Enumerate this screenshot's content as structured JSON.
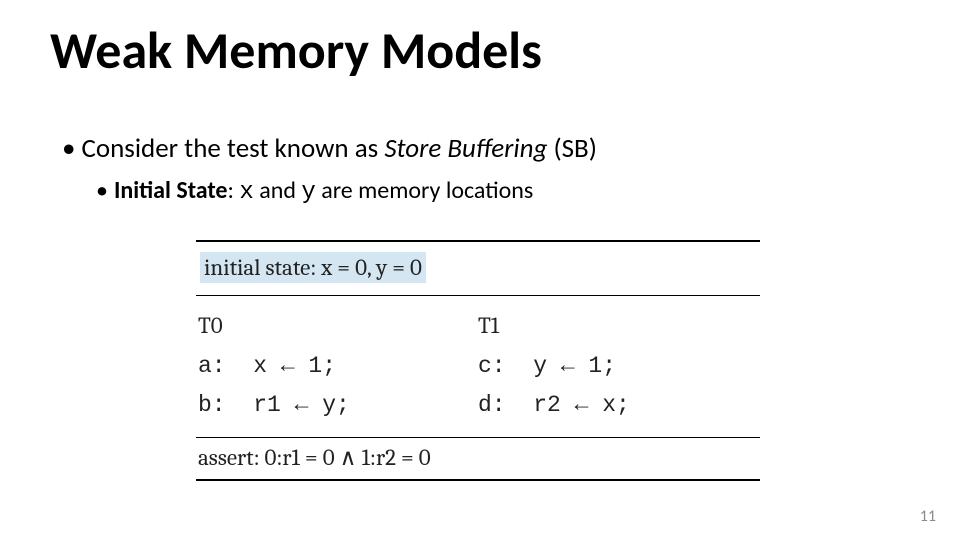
{
  "title": "Weak Memory Models",
  "bullet1": {
    "pre": "Consider the test known as ",
    "em": "Store Buffering",
    "post": " (SB)"
  },
  "bullet2": {
    "label": "Initial State",
    "sep": ": ",
    "x": "x",
    "mid": " and ",
    "y": "y",
    "tail": " are memory locations"
  },
  "table": {
    "initial": "initial state: x = 0, y = 0",
    "t0": {
      "head": "T0",
      "l1": "a:  x ← 1;",
      "l2": "b:  r1 ← y;"
    },
    "t1": {
      "head": "T1",
      "l1": "c:  y ← 1;",
      "l2": "d:  r2 ← x;"
    },
    "assert": "assert: 0:r1 = 0 ∧ 1:r2 = 0"
  },
  "page": "11"
}
